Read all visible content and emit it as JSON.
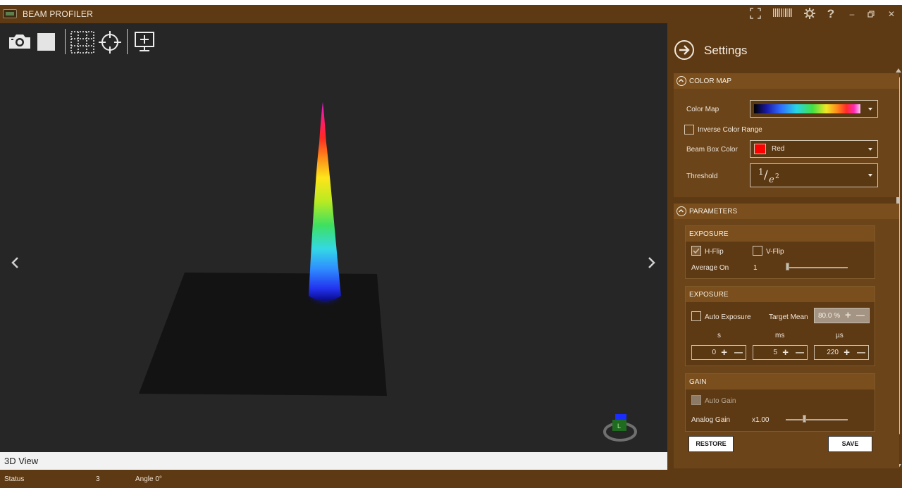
{
  "window": {
    "title": "BEAM PROFILER",
    "controls": [
      "fullscreen-icon",
      "barcode-icon",
      "gear-icon",
      "help-icon",
      "minimize-icon",
      "restore-icon",
      "close-icon"
    ],
    "help_glyph": "?",
    "minimize_glyph": "–",
    "close_glyph": "✕"
  },
  "toolbar": {
    "tools": [
      "camera-icon",
      "stop-icon",
      "grid-select-icon",
      "crosshair-icon",
      "display-add-icon"
    ]
  },
  "viewport": {
    "view_label": "3D View",
    "orientation_cube_face": "L",
    "colors": {
      "background": "#262626",
      "plane": "#141414"
    }
  },
  "status": {
    "label": "Status",
    "value": "3",
    "angle": "Angle 0°"
  },
  "settings": {
    "title": "Settings",
    "color_map_section": {
      "header": "COLOR MAP",
      "color_map_label": "Color Map",
      "inverse_label": "Inverse Color Range",
      "inverse_checked": false,
      "beam_box_label": "Beam Box Color",
      "beam_box_value": "Red",
      "beam_box_swatch": "#ff0000",
      "threshold_label": "Threshold",
      "threshold_numerator": "1",
      "threshold_slash": "/",
      "threshold_denominator": "e",
      "threshold_exponent": "2"
    },
    "parameters_section": {
      "header": "PARAMETERS",
      "flip_group": {
        "header": "EXPOSURE",
        "hflip_label": "H-Flip",
        "hflip_checked": true,
        "vflip_label": "V-Flip",
        "vflip_checked": false,
        "average_label": "Average On",
        "average_value": "1"
      },
      "exposure_group": {
        "header": "EXPOSURE",
        "auto_label": "Auto Exposure",
        "auto_checked": false,
        "target_mean_label": "Target Mean",
        "target_mean_value": "80.0 %",
        "col_s": "s",
        "col_ms": "ms",
        "col_us": "µs",
        "s_value": "0",
        "ms_value": "5",
        "us_value": "220"
      },
      "gain_group": {
        "header": "GAIN",
        "auto_gain_label": "Auto Gain",
        "analog_gain_label": "Analog Gain",
        "analog_gain_value": "x1.00"
      },
      "plus_glyph": "+",
      "minus_glyph": "—"
    },
    "restore_label": "RESTORE",
    "save_label": "SAVE"
  }
}
